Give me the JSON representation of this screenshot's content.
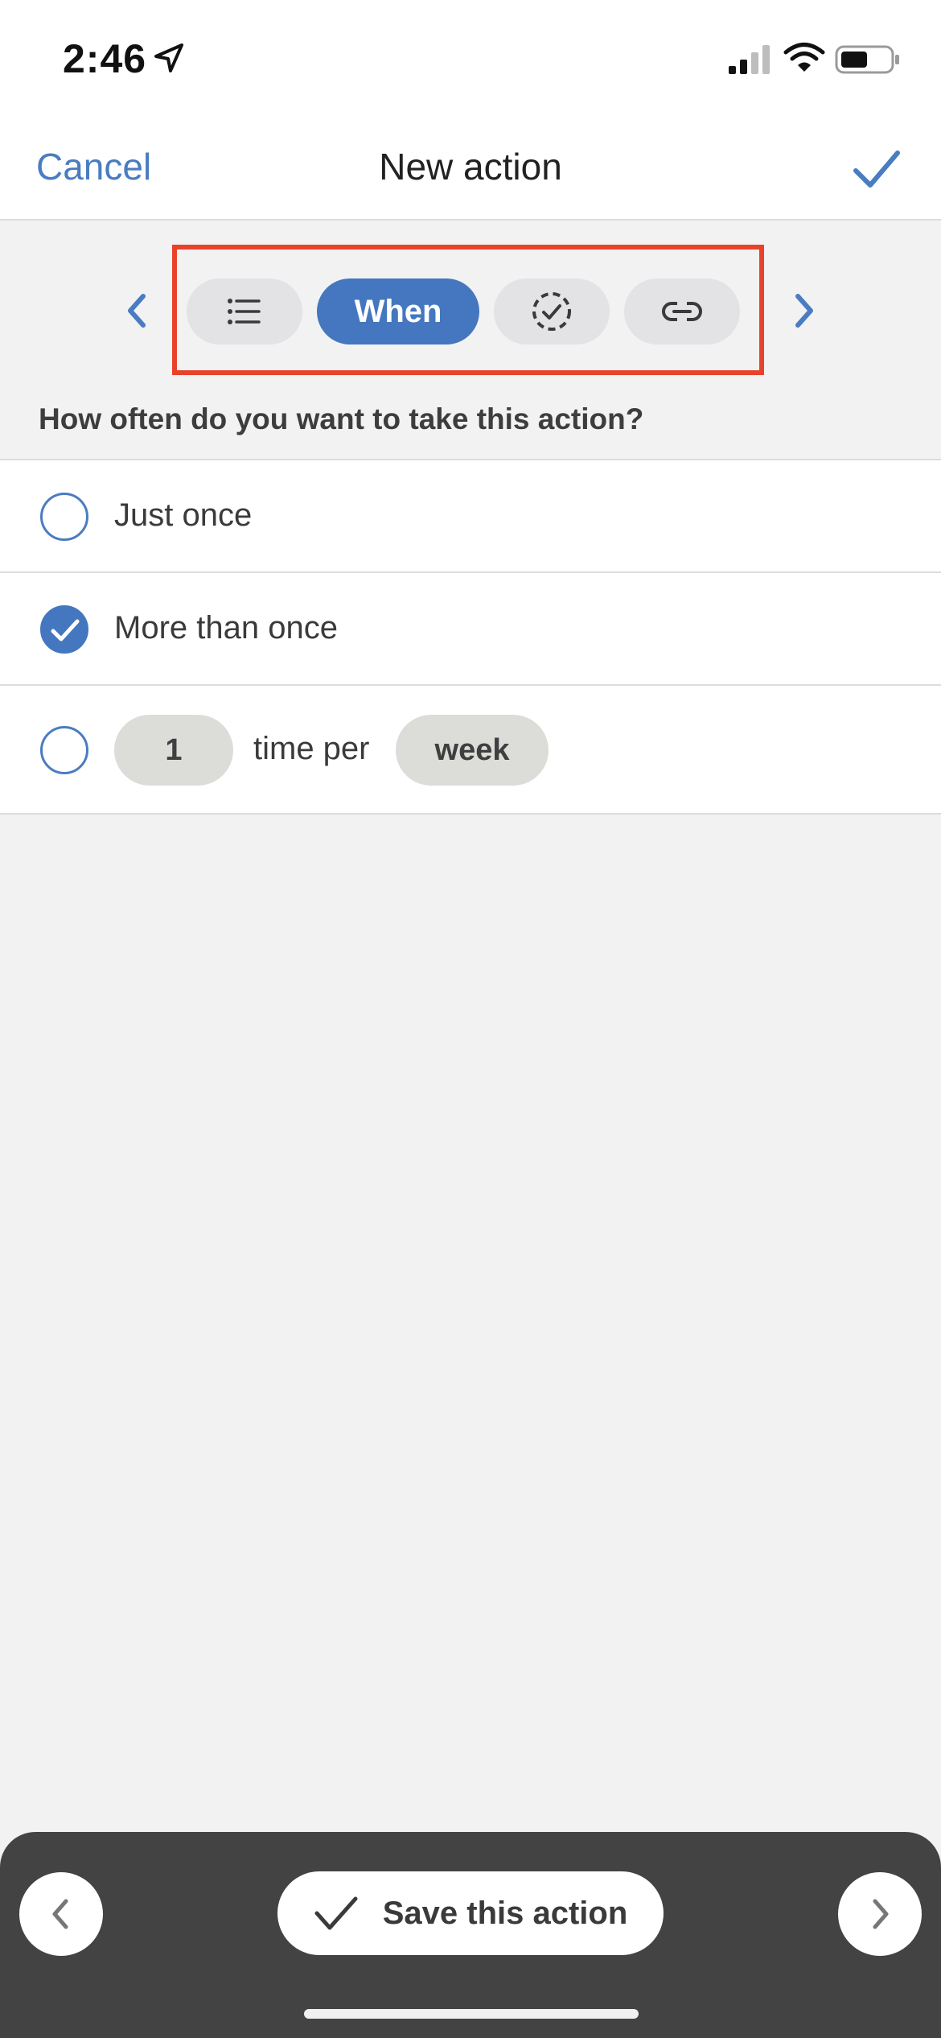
{
  "status_bar": {
    "time": "2:46",
    "icons": [
      "location-arrow-icon",
      "cellular-signal-icon",
      "wifi-icon",
      "battery-icon"
    ]
  },
  "nav": {
    "cancel_label": "Cancel",
    "title": "New action",
    "confirm_icon": "checkmark-icon"
  },
  "stepper": {
    "prev_icon": "chevron-left-icon",
    "next_icon": "chevron-right-icon",
    "steps": [
      {
        "icon": "list-icon",
        "label": ""
      },
      {
        "icon": "",
        "label": "When",
        "active": true
      },
      {
        "icon": "dashed-circle-check-icon",
        "label": ""
      },
      {
        "icon": "link-icon",
        "label": ""
      }
    ],
    "highlight_color": "#e8432a"
  },
  "question": "How often do you want to take this action?",
  "options": [
    {
      "label": "Just once",
      "selected": false
    },
    {
      "label": "More than once",
      "selected": true
    }
  ],
  "frequency": {
    "selected": false,
    "count": "1",
    "middle_text": "time per",
    "period": "week"
  },
  "bottom_bar": {
    "prev_icon": "chevron-left-icon",
    "save_icon": "checkmark-icon",
    "save_label": "Save this action",
    "next_icon": "chevron-right-icon"
  },
  "colors": {
    "accent": "#4477bf",
    "background": "#f2f2f2",
    "bottom_bar": "#434343"
  }
}
